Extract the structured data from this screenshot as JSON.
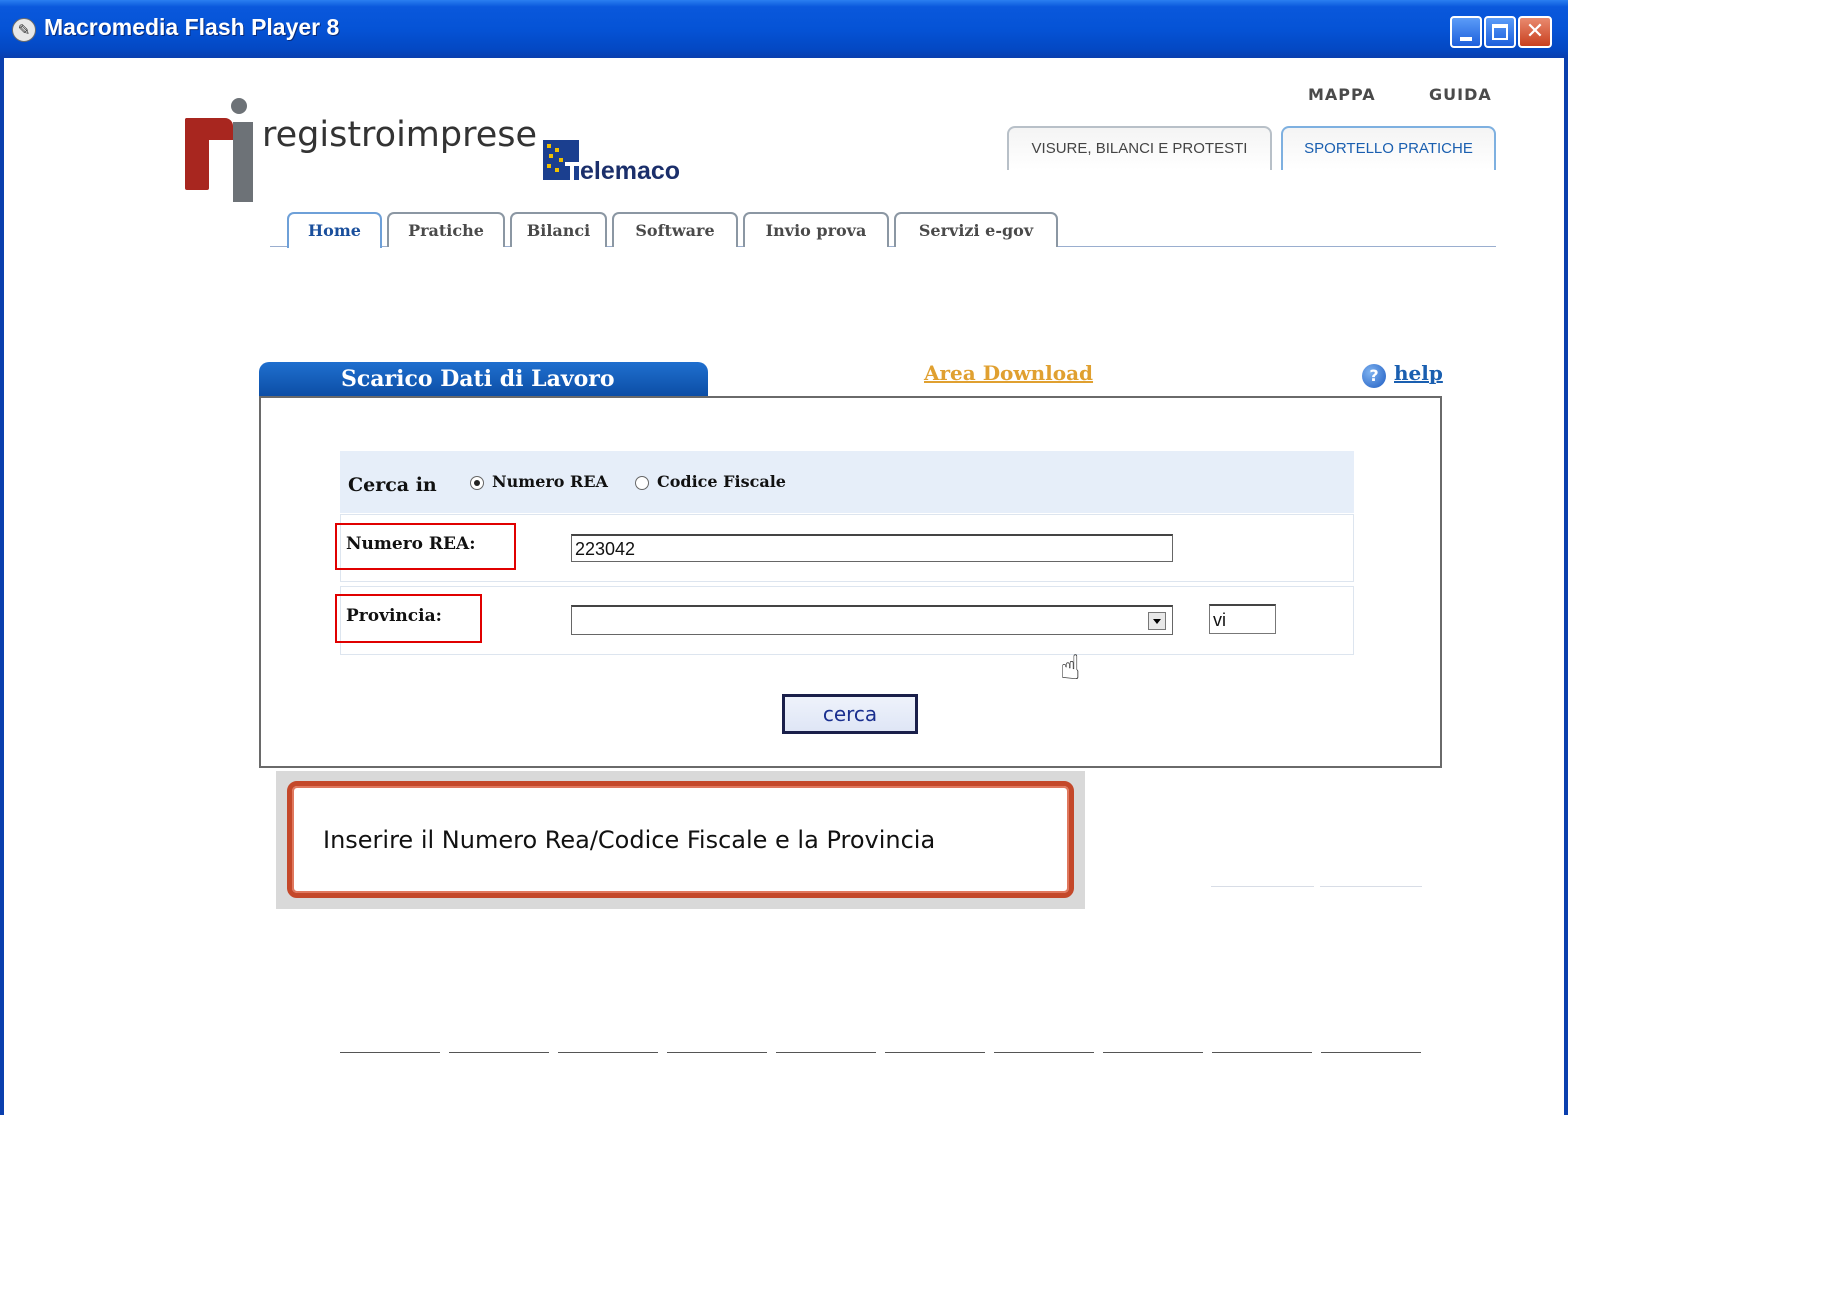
{
  "window": {
    "title": "Macromedia Flash Player 8",
    "controls": [
      "minimize",
      "maximize",
      "close"
    ],
    "app_icon": "flash-player-icon"
  },
  "logo": {
    "name": "registroimprese",
    "partner": "elemaco"
  },
  "top_links": {
    "mappa": "MAPPA",
    "guida": "GUIDA"
  },
  "section_tabs": [
    {
      "label": "VISURE, BILANCI E PROTESTI",
      "active": false
    },
    {
      "label": "SPORTELLO PRATICHE",
      "active": true
    }
  ],
  "nav_tabs": [
    {
      "label": "Home",
      "active": true
    },
    {
      "label": "Pratiche",
      "active": false
    },
    {
      "label": "Bilanci",
      "active": false
    },
    {
      "label": "Software",
      "active": false
    },
    {
      "label": "Invio prova",
      "active": false
    },
    {
      "label": "Servizi e-gov",
      "active": false
    }
  ],
  "panel": {
    "title": "Scarico Dati di Lavoro",
    "area_download": "Area Download",
    "help": "help"
  },
  "search": {
    "cerca_in_label": "Cerca in",
    "options": [
      {
        "label": "Numero REA",
        "selected": true
      },
      {
        "label": "Codice Fiscale",
        "selected": false
      }
    ],
    "numero_rea_label": "Numero REA:",
    "numero_rea_value": "223042",
    "provincia_label": "Provincia:",
    "provincia_selected": "",
    "provincia_code_value": "vi",
    "submit_label": "cerca"
  },
  "tooltip": {
    "text": "Inserire il Numero Rea/Codice Fiscale e la Provincia"
  },
  "colors": {
    "titlebar": "#0553d6",
    "panel_tab": "#0b4ca3",
    "area_download": "#e0a030",
    "highlight_box": "#e00000",
    "tooltip_border": "#c4482a"
  }
}
